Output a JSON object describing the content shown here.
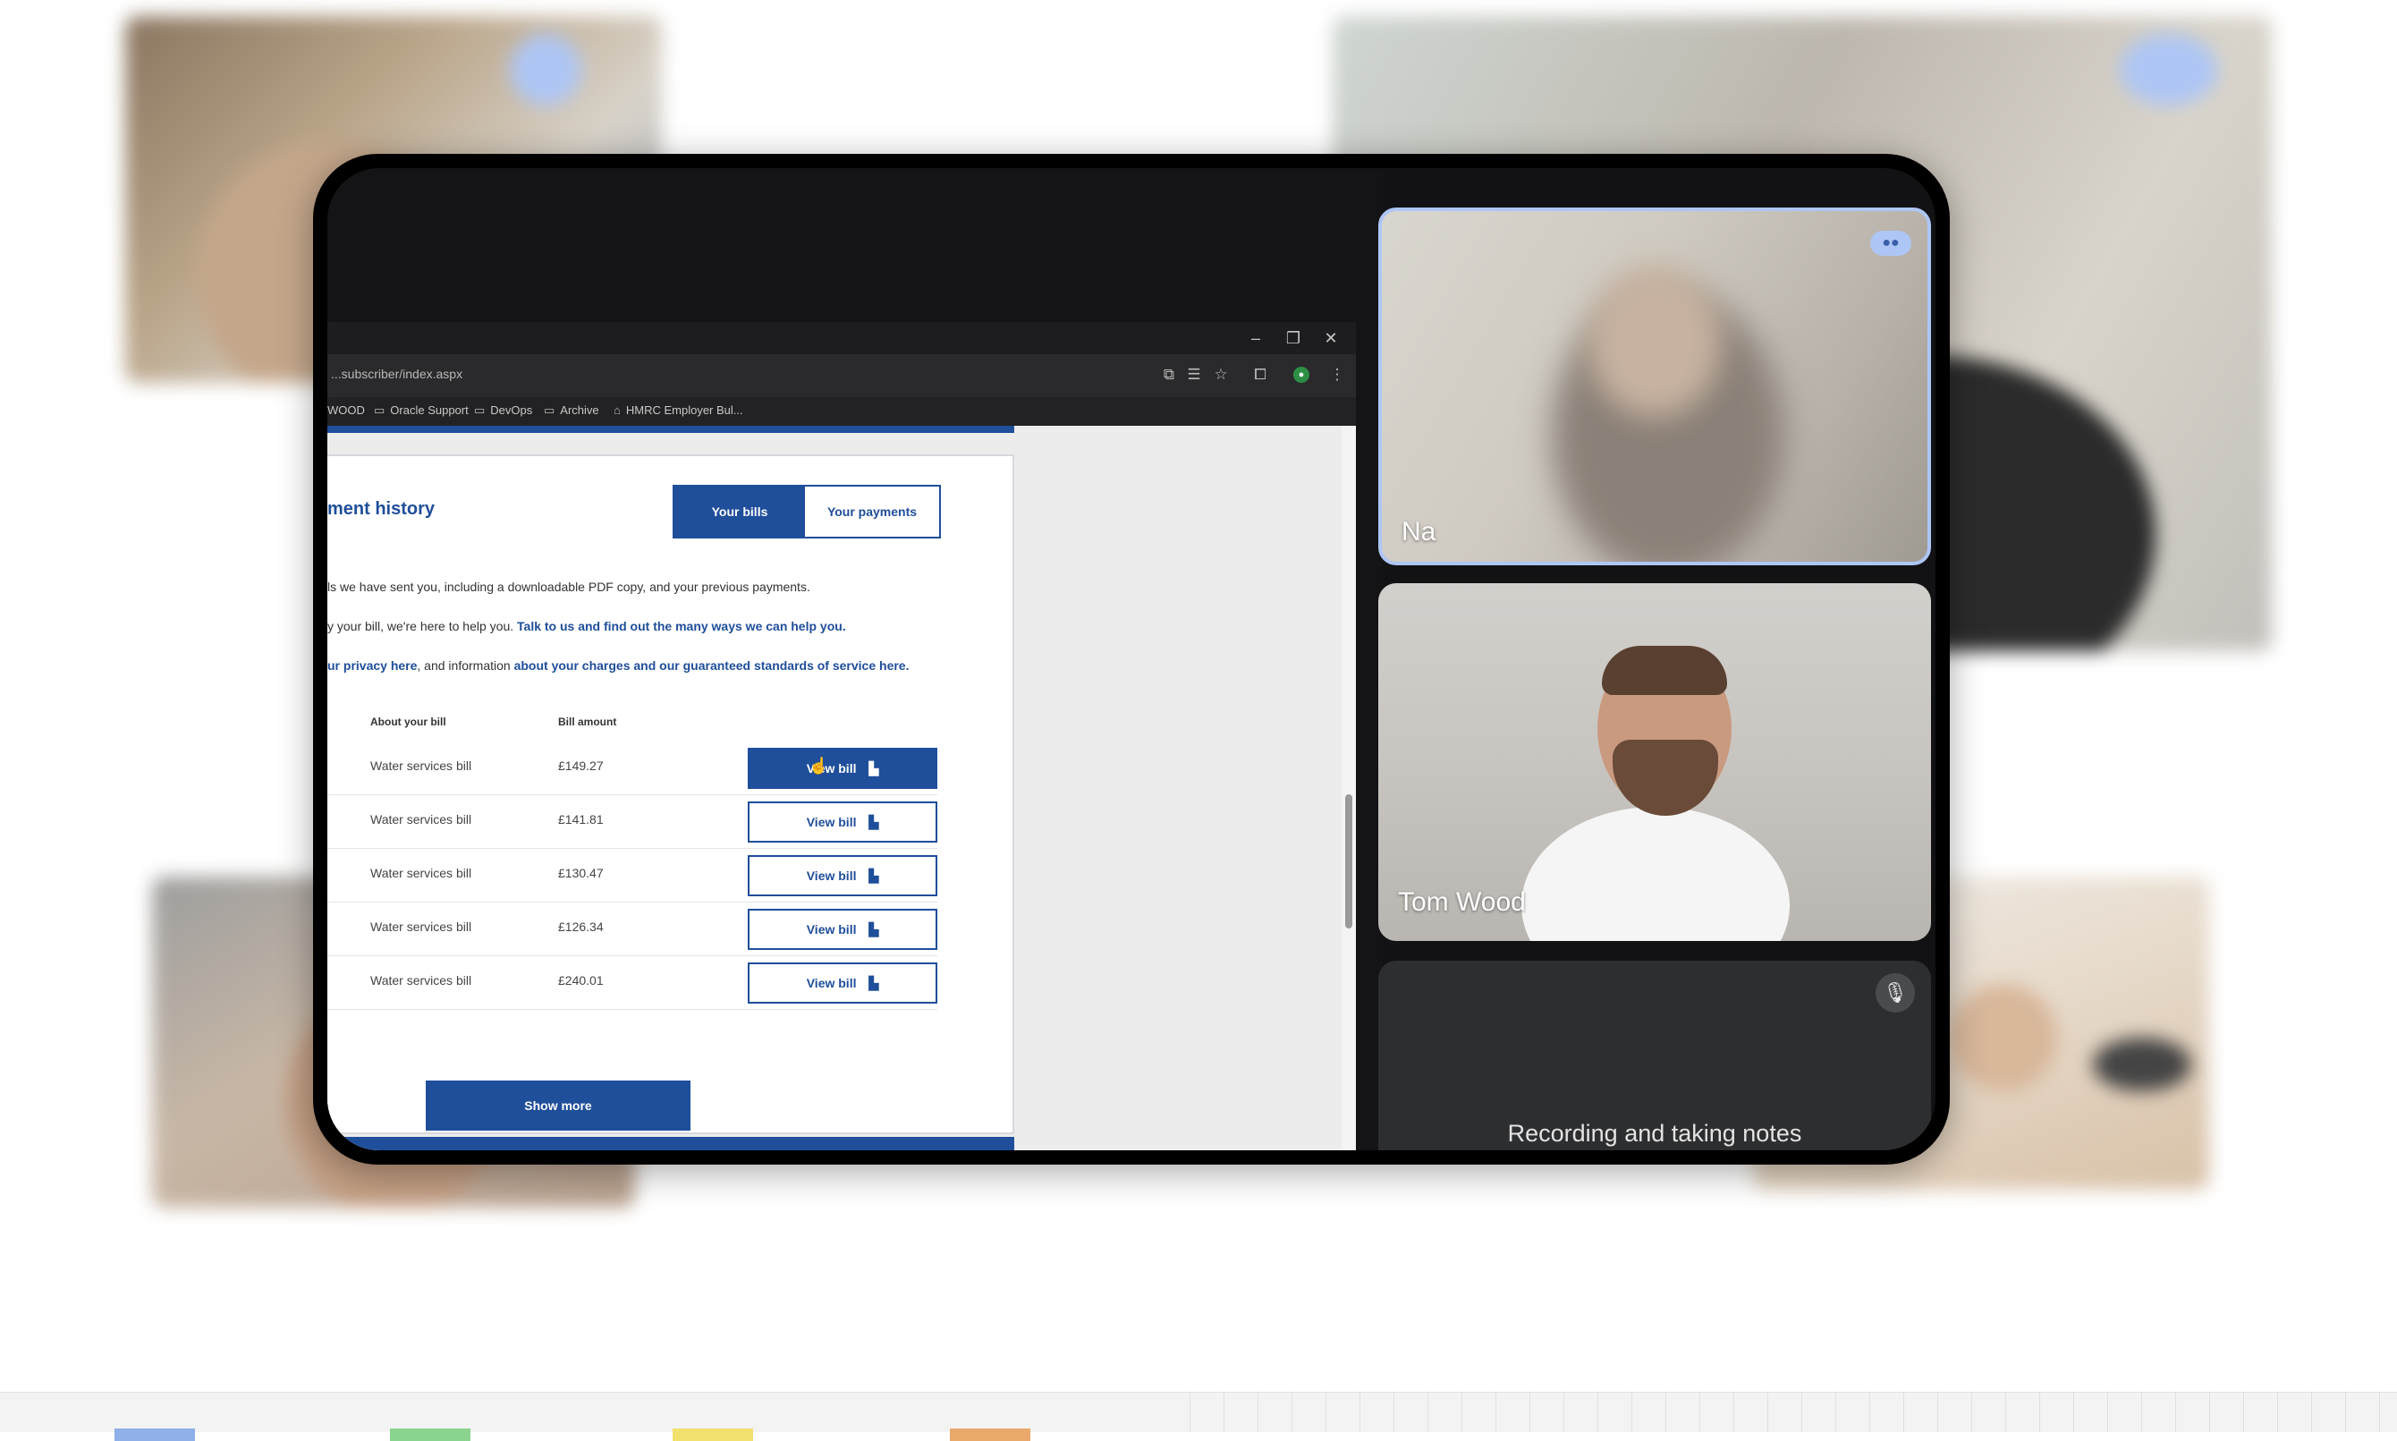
{
  "browser": {
    "url": "...subscriber/index.aspx",
    "bookmarks": [
      "WOOD",
      "Oracle Support",
      "DevOps",
      "Archive",
      "HMRC Employer Bul..."
    ]
  },
  "page": {
    "heading": "ment history",
    "tabs": {
      "bills": "Your bills",
      "payments": "Your payments"
    },
    "para1": "ls we have sent you, including a downloadable PDF copy, and your previous payments.",
    "para2_pre": "y your bill, we're here to help you.",
    "para2_link": "Talk to us and find out the many ways we can help you.",
    "para3_link1": "ur privacy here",
    "para3_mid": ", and information",
    "para3_link2": "about your charges and our guaranteed standards of service here.",
    "col_about": "About your bill",
    "col_amount": "Bill amount",
    "view_label": "View bill",
    "rows": [
      {
        "desc": "Water services bill",
        "amount": "£149.27"
      },
      {
        "desc": "Water services bill",
        "amount": "£141.81"
      },
      {
        "desc": "Water services bill",
        "amount": "£130.47"
      },
      {
        "desc": "Water services bill",
        "amount": "£126.34"
      },
      {
        "desc": "Water services bill",
        "amount": "£240.01"
      }
    ],
    "show_more": "Show more"
  },
  "participants": {
    "tile1_name": "Na",
    "tile2_name": "Tom Wood",
    "tile3_status": "Recording and taking notes"
  },
  "icons": {
    "minimize": "minimize-icon",
    "restore": "restore-icon",
    "close": "close-icon",
    "pdf": "pdf-icon",
    "mic_off": "mic-off-icon",
    "speaking": "speaking-indicator-icon"
  },
  "colors": {
    "brand_blue": "#1f4e9a",
    "speaker_highlight": "#aec6f5"
  }
}
